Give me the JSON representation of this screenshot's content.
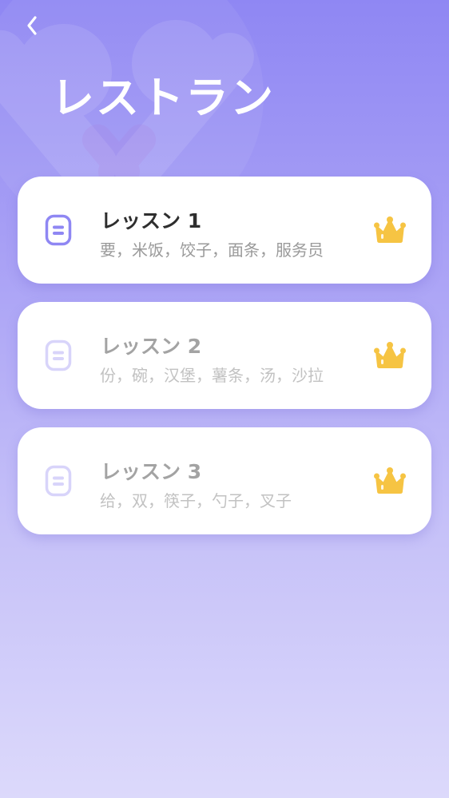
{
  "header": {
    "title": "レストラン"
  },
  "lessons": [
    {
      "title": "レッスン 1",
      "words": "要，米饭，饺子，面条，服务员",
      "state": "active"
    },
    {
      "title": "レッスン 2",
      "words": "份，碗，汉堡，薯条，汤，沙拉",
      "state": "locked"
    },
    {
      "title": "レッスン 3",
      "words": "给，双，筷子，勺子，叉子",
      "state": "locked"
    }
  ],
  "icons": {
    "back": "chevron-left-icon",
    "lesson": "document-icon",
    "premium": "crown-icon",
    "background": "fork-knife-icon"
  },
  "colors": {
    "accent": "#8f87f3",
    "crown": "#f6c443",
    "icon_active": "#8f87f3",
    "icon_locked": "#d8d4fa"
  }
}
